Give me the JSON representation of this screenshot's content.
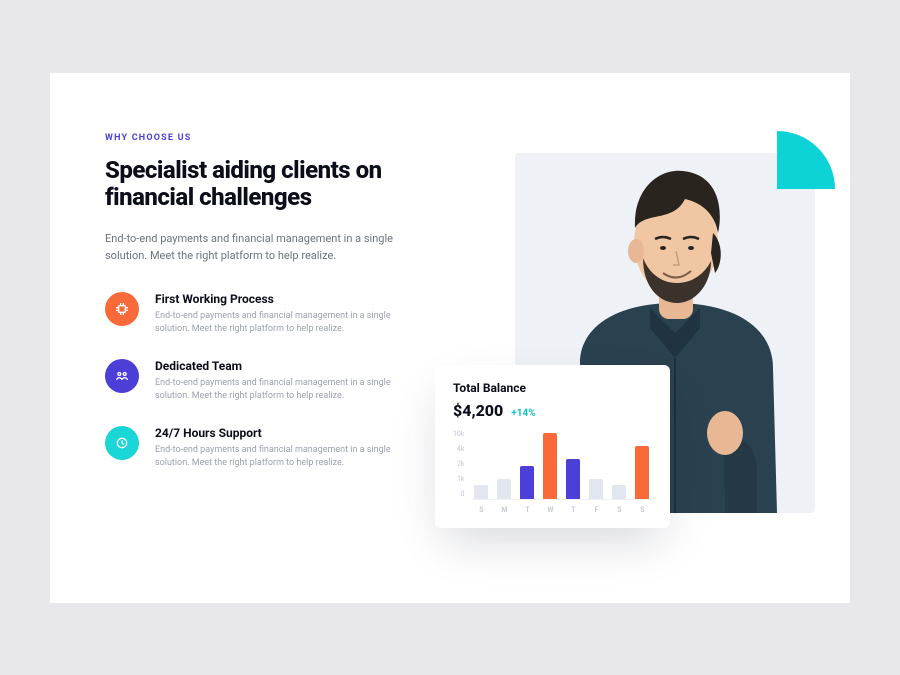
{
  "eyebrow": "WHY CHOOSE US",
  "headline": "Specialist  aiding clients on financial challenges",
  "subcopy": "End-to-end payments and financial management in a single solution. Meet the right platform to help realize.",
  "features": [
    {
      "title": "First Working Process",
      "text": "End-to-end payments and financial management in a single solution. Meet the right platform to help realize.",
      "icon": "chip-icon",
      "color": "orange"
    },
    {
      "title": "Dedicated Team",
      "text": "End-to-end payments and financial management in a single solution. Meet the right platform to help realize.",
      "icon": "team-icon",
      "color": "purple"
    },
    {
      "title": "24/7 Hours Support",
      "text": "End-to-end payments and financial management in a single solution. Meet the right platform to help realize.",
      "icon": "support-icon",
      "color": "cyan"
    }
  ],
  "balance": {
    "title": "Total Balance",
    "amount": "$4,200",
    "delta": "+14%"
  },
  "chart_data": {
    "type": "bar",
    "title": "Total Balance",
    "categories": [
      "S",
      "M",
      "T",
      "W",
      "T",
      "F",
      "S",
      "S"
    ],
    "values": [
      2,
      3,
      5,
      10,
      6,
      3,
      2,
      8
    ],
    "ylabel": "",
    "xlabel": "",
    "ylim": [
      0,
      10
    ],
    "y_ticks": [
      "10k",
      "4k",
      "2k",
      "1k",
      "0"
    ],
    "bar_styles": [
      "muted",
      "muted",
      "purple",
      "orange",
      "purple",
      "muted",
      "muted",
      "orange"
    ]
  }
}
